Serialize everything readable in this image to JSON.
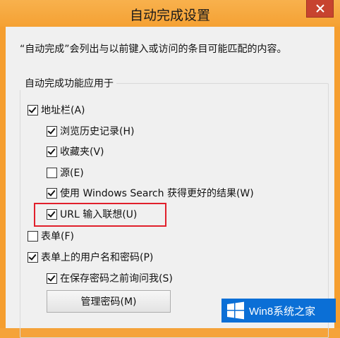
{
  "window": {
    "title": "自动完成设置",
    "close_icon": "close-icon"
  },
  "description": "“自动完成”会列出与以前键入或访问的条目可能匹配的内容。",
  "group": {
    "label": "自动完成功能应用于",
    "items": [
      {
        "label": "地址栏(A)",
        "checked": true
      },
      {
        "label": "浏览历史记录(H)",
        "checked": true
      },
      {
        "label": "收藏夹(V)",
        "checked": true
      },
      {
        "label": "源(E)",
        "checked": false
      },
      {
        "label": "使用 Windows Search 获得更好的结果(W)",
        "checked": true
      },
      {
        "label": "URL 输入联想(U)",
        "checked": true
      },
      {
        "label": "表单(F)",
        "checked": false
      },
      {
        "label": "表单上的用户名和密码(P)",
        "checked": true
      },
      {
        "label": "在保存密码之前询问我(S)",
        "checked": true
      }
    ],
    "manage_button": "管理密码(M)"
  },
  "watermark": {
    "text": "Win8系统之家",
    "icon": "windows-logo-icon"
  }
}
